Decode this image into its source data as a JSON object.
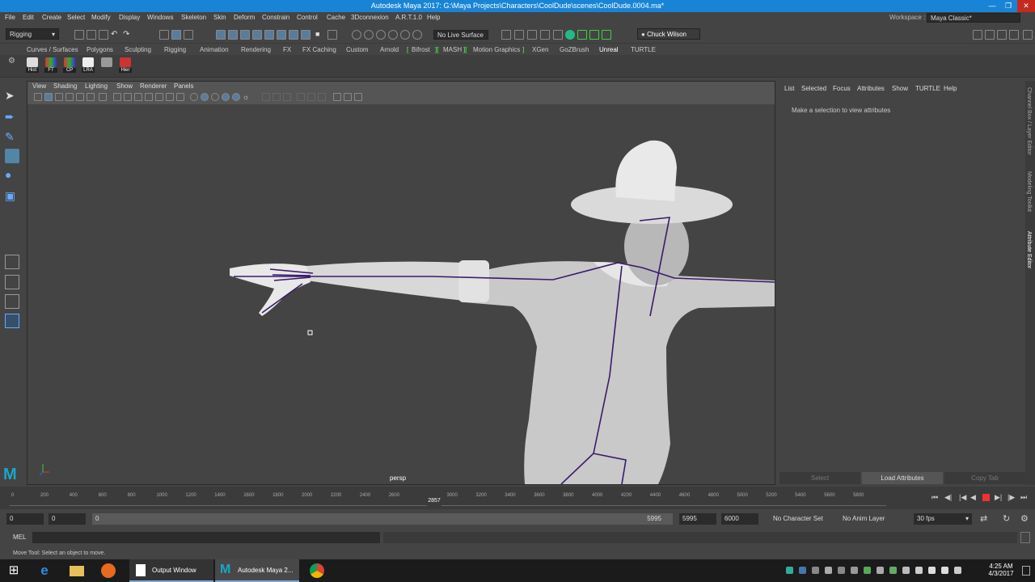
{
  "window": {
    "title": "Autodesk Maya 2017: G:\\Maya Projects\\Characters\\CoolDude\\scenes\\CoolDude.0004.ma*"
  },
  "menubar": {
    "items": [
      "File",
      "Edit",
      "Create",
      "Select",
      "Modify",
      "Display",
      "Windows",
      "Skeleton",
      "Skin",
      "Deform",
      "Constrain",
      "Control",
      "Cache",
      "3Dconnexion",
      "A.R.T.1.0",
      "Help"
    ]
  },
  "workspace": {
    "label": "Workspace :",
    "value": "Maya Classic*"
  },
  "statusline": {
    "menuset": "Rigging",
    "live_surface": "No Live Surface",
    "user": "Chuck Wilson"
  },
  "shelf": {
    "tabs": [
      "Curves / Surfaces",
      "Polygons",
      "Sculpting",
      "Rigging",
      "Animation",
      "Rendering",
      "FX",
      "FX Caching",
      "Custom",
      "Arnold",
      "Bifrost",
      "MASH",
      "Motion Graphics",
      "XGen",
      "GoZBrush",
      "Unreal",
      "TURTLE"
    ],
    "active_tab": "Unreal",
    "buttons": [
      "Hist",
      "FT",
      "CP",
      "LRA",
      "Hier"
    ]
  },
  "viewport": {
    "menus": [
      "View",
      "Shading",
      "Lighting",
      "Show",
      "Renderer",
      "Panels"
    ],
    "camera_label": "persp"
  },
  "attribute_editor": {
    "menus": [
      "List",
      "Selected",
      "Focus",
      "Attributes",
      "Show",
      "TURTLE",
      "Help"
    ],
    "message": "Make a selection to view attributes",
    "buttons": [
      "Select",
      "Load Attributes",
      "Copy Tab"
    ]
  },
  "side_tabs": [
    "Channel Box / Layer Editor",
    "Modeling Toolkit",
    "Attribute Editor"
  ],
  "timeslider": {
    "ticks": [
      "0",
      "200",
      "400",
      "600",
      "800",
      "1000",
      "1200",
      "1400",
      "1600",
      "1800",
      "2000",
      "2200",
      "2400",
      "2600",
      "2857",
      "3000",
      "3200",
      "3400",
      "3600",
      "3800",
      "4000",
      "4200",
      "4400",
      "4600",
      "4800",
      "5000",
      "5200",
      "5400",
      "5600",
      "5800"
    ],
    "current": "2857"
  },
  "range": {
    "start": "0",
    "playback_start": "0",
    "slider_start": "0",
    "slider_end": "5995",
    "playback_end": "5995",
    "end": "6000",
    "character_set": "No Character Set",
    "anim_layer": "No Anim Layer",
    "fps": "30 fps"
  },
  "cmdline": {
    "label": "MEL"
  },
  "helpline": {
    "text": "Move Tool: Select an object to move."
  },
  "taskbar": {
    "items": [
      "Output Window",
      "Autodesk Maya 2..."
    ],
    "time": "4:25 AM",
    "date": "4/3/2017"
  },
  "colors": {
    "accent": "#1984d6",
    "joint": "#3a1a6a"
  }
}
